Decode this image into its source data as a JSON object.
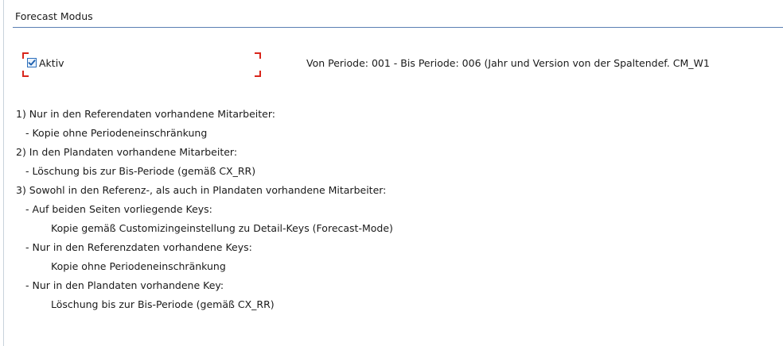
{
  "group": {
    "title": "Forecast Modus"
  },
  "checkbox": {
    "label": "Aktiv",
    "checked": true
  },
  "period_info": "Von Periode: 001 - Bis Periode: 006 (Jahr und Version von der Spaltendef. CM_W1",
  "rules": [
    {
      "text": "1) Nur in den Referendaten vorhandene Mitarbeiter:",
      "indent": 0
    },
    {
      "text": "- Kopie ohne Periodeneinschränkung",
      "indent": 1
    },
    {
      "text": "2) In den Plandaten vorhandene Mitarbeiter:",
      "indent": 0
    },
    {
      "text": "- Löschung bis zur Bis-Periode (gemäß CX_RR)",
      "indent": 1
    },
    {
      "text": "3) Sowohl in den Referenz-, als auch in Plandaten vorhandene Mitarbeiter:",
      "indent": 0
    },
    {
      "text": "- Auf beiden Seiten vorliegende Keys:",
      "indent": 1
    },
    {
      "text": "Kopie gemäß Customizingeinstellung zu Detail-Keys (Forecast-Mode)",
      "indent": 2
    },
    {
      "text": "- Nur in den Referenzdaten vorhandene Keys:",
      "indent": 1
    },
    {
      "text": "Kopie ohne Periodeneinschränkung",
      "indent": 2
    },
    {
      "text": "- Nur in den Plandaten vorhandene Key:",
      "indent": 1
    },
    {
      "text": "Löschung bis zur Bis-Periode (gemäß CX_RR)",
      "indent": 2
    }
  ],
  "colors": {
    "header_rule": "#5a7fb3",
    "focus_marker": "#d9261c",
    "checkbox_border": "#2c6fbb"
  },
  "icons": {
    "checkmark": "checkmark-icon"
  }
}
